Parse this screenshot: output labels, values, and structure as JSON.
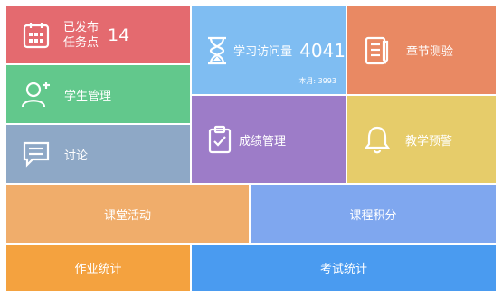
{
  "tiles": {
    "published": {
      "label_line1": "已发布",
      "label_line2": "任务点",
      "count": "14",
      "icon": "calendar-icon",
      "color": "#e46a6f"
    },
    "visits": {
      "label": "学习访问量",
      "count": "4041",
      "monthly_label": "本月: 3993",
      "icon": "hourglass-icon",
      "color": "#7fbdf2"
    },
    "chapter_quiz": {
      "label": "章节测验",
      "icon": "document-icon",
      "color": "#e98963"
    },
    "student_mgmt": {
      "label": "学生管理",
      "icon": "user-add-icon",
      "color": "#62c88c"
    },
    "discussion": {
      "label": "讨论",
      "icon": "chat-icon",
      "color": "#8ea8c6"
    },
    "grade_mgmt": {
      "label": "成绩管理",
      "icon": "clipboard-check-icon",
      "color": "#9d7cc8"
    },
    "teaching_alert": {
      "label": "教学预警",
      "icon": "bell-icon",
      "color": "#e6cc6a"
    },
    "class_activity": {
      "label": "课堂活动",
      "color": "#f0ad6b"
    },
    "course_points": {
      "label": "课程积分",
      "color": "#7fa7ef"
    },
    "homework_stats": {
      "label": "作业统计",
      "color": "#f4a23f"
    },
    "exam_stats": {
      "label": "考试统计",
      "color": "#4a9bf0"
    }
  }
}
